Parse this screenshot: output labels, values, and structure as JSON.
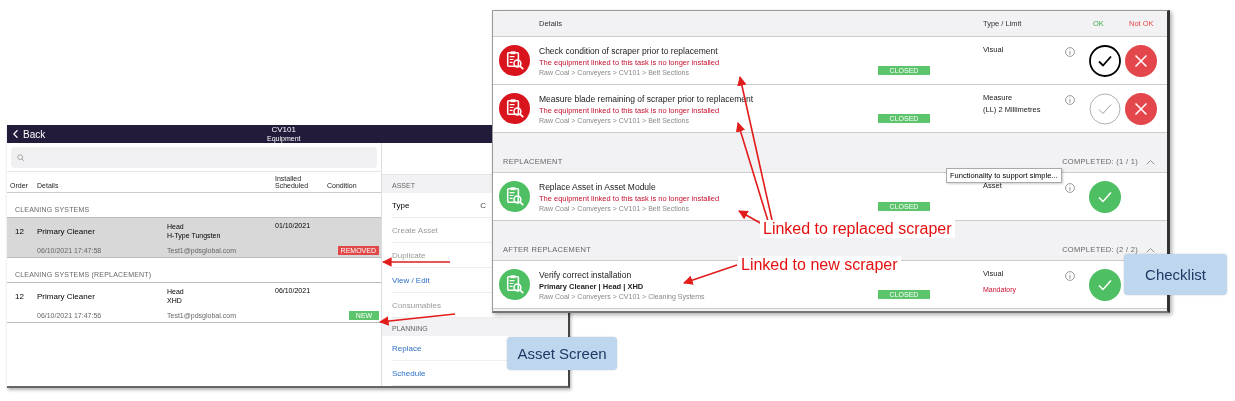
{
  "asset_screen": {
    "back": "Back",
    "title": "CV101",
    "subtitle": "Equipment",
    "columns": [
      "Order",
      "Details",
      "Installed\nScheduled",
      "Condition"
    ],
    "groups": [
      {
        "title": "CLEANING SYSTEMS",
        "rows": [
          {
            "order": "12",
            "name": "Primary Cleaner",
            "part": "Head",
            "type": "H-Type Tungsten",
            "date": "01/10/2021",
            "timestamp": "06/10/2021 17:47:58",
            "user": "Test1@pdsglobal.com",
            "condition": "REMOVED",
            "color": "#e04848",
            "selected": true
          }
        ]
      },
      {
        "title": "CLEANING SYSTEMS (REPLACEMENT)",
        "rows": [
          {
            "order": "12",
            "name": "Primary Cleaner",
            "part": "Head",
            "type": "XHD",
            "date": "06/10/2021",
            "timestamp": "06/10/2021 17:47:56",
            "user": "Test1@pdsglobal.com",
            "condition": "NEW",
            "color": "#5cc46a",
            "selected": false
          }
        ]
      }
    ],
    "menu": [
      {
        "kind": "header",
        "label": "ASSET"
      },
      {
        "kind": "field",
        "label": "Type",
        "value": "C"
      },
      {
        "kind": "item",
        "label": "Create Asset",
        "disabled": true
      },
      {
        "kind": "item",
        "label": "Duplicate",
        "disabled": true
      },
      {
        "kind": "item",
        "label": "View / Edit",
        "disabled": false
      },
      {
        "kind": "item",
        "label": "Consumables",
        "disabled": true
      },
      {
        "kind": "header",
        "label": "PLANNING"
      },
      {
        "kind": "item",
        "label": "Replace",
        "disabled": false
      },
      {
        "kind": "item",
        "label": "Schedule",
        "disabled": false
      }
    ]
  },
  "checklist": {
    "columns": [
      "Details",
      "Type / Limit",
      "OK",
      "Not OK"
    ],
    "sections": [
      {
        "tasks": [
          {
            "title": "Check condition of scraper prior to replacement",
            "note": "The equipment linked to this task is no longer installed",
            "warning": true,
            "path": "Raw Coal > Conveyers > CV101 > Belt Sections",
            "status": "CLOSED",
            "type": [
              "Visual"
            ],
            "passed": false,
            "ok_highlighted": true
          },
          {
            "title": "Measure blade remaining of scraper prior to replacement",
            "note": "The equipment linked to this task is no longer installed",
            "warning": true,
            "path": "Raw Coal > Conveyers > CV101 > Belt Sections",
            "status": "CLOSED",
            "type": [
              "Measure",
              "(LL) 2 Millimetres"
            ],
            "passed": false,
            "ok_highlighted": false
          }
        ]
      },
      {
        "title": "REPLACEMENT",
        "completed": "COMPLETED: (1 / 1)",
        "tasks": [
          {
            "title": "Replace Asset in Asset Module",
            "note": "The equipment linked to this task is no longer installed",
            "warning": true,
            "path": "Raw Coal > Conveyers > CV101 > Belt Sections",
            "status": "CLOSED",
            "type": [
              "Asset"
            ],
            "passed": true
          }
        ]
      },
      {
        "title": "AFTER REPLACEMENT",
        "completed": "COMPLETED: (2 / 2)",
        "tasks": [
          {
            "title": "Verify correct installation",
            "note": "Primary Cleaner | Head  | XHD",
            "warning": false,
            "path": "Raw Coal > Conveyers > CV101 > Cleaning Systems",
            "status": "CLOSED",
            "type": [
              "Visual"
            ],
            "mandatory": "Mandatory",
            "passed": true
          }
        ]
      }
    ],
    "tooltip": "Functionality to support simple..."
  },
  "annotations": [
    "Linked to replaced scraper",
    "Linked to new scraper"
  ],
  "callouts": [
    "Asset Screen",
    "Checklist"
  ]
}
